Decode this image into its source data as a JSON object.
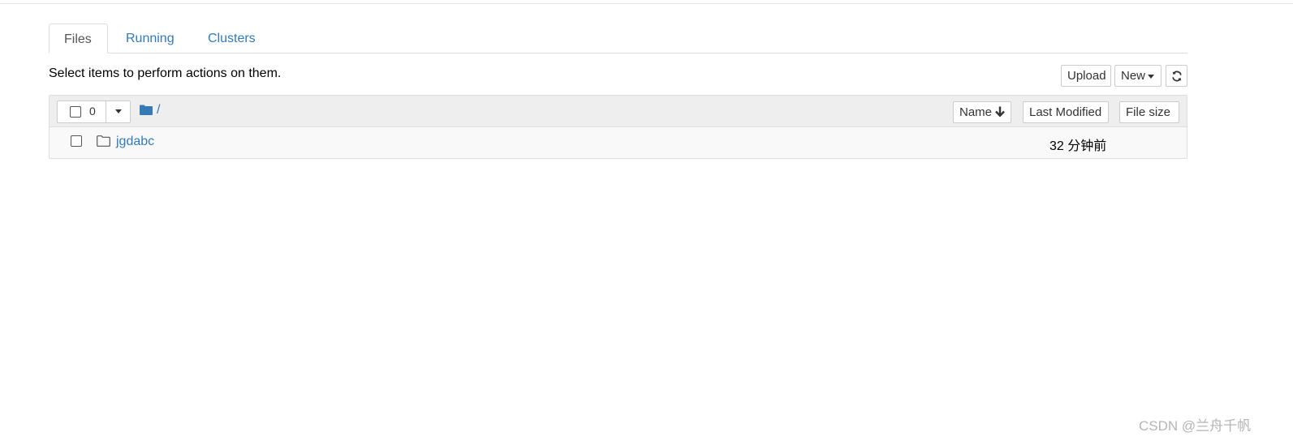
{
  "tabs": [
    {
      "label": "Files",
      "active": true
    },
    {
      "label": "Running",
      "active": false
    },
    {
      "label": "Clusters",
      "active": false
    }
  ],
  "toolbar": {
    "hint": "Select items to perform actions on them.",
    "upload_label": "Upload",
    "new_label": "New"
  },
  "list": {
    "selected_count": "0",
    "breadcrumb": "/",
    "columns": {
      "name": "Name",
      "last_modified": "Last Modified",
      "file_size": "File size"
    },
    "items": [
      {
        "name": "jgdabc",
        "type": "folder",
        "last_modified": "32 分钟前",
        "file_size": ""
      }
    ]
  },
  "watermark": "CSDN @兰舟千帆",
  "colors": {
    "link": "#337ab7",
    "header_bg": "#eeeeee",
    "row_bg": "#f9f9f9",
    "border": "#dddddd"
  }
}
